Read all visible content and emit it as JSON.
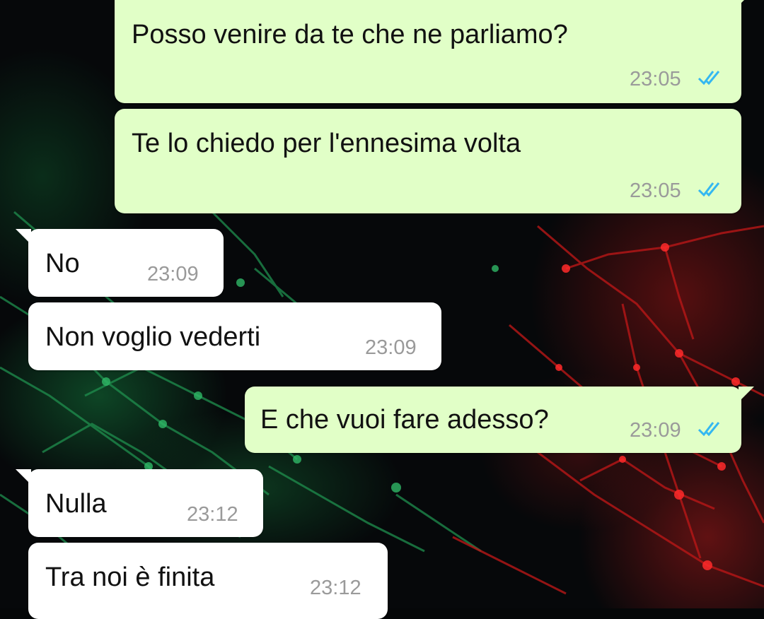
{
  "chat": {
    "messages": [
      {
        "direction": "outgoing",
        "text": "Posso venire da te che ne parliamo?",
        "time": "23:05",
        "status": "read"
      },
      {
        "direction": "outgoing",
        "text": "Te lo chiedo per l'ennesima volta",
        "time": "23:05",
        "status": "read"
      },
      {
        "direction": "incoming",
        "text": "No",
        "time": "23:09"
      },
      {
        "direction": "incoming",
        "text": "Non voglio vederti",
        "time": "23:09"
      },
      {
        "direction": "outgoing",
        "text": "E che vuoi fare adesso?",
        "time": "23:09",
        "status": "read"
      },
      {
        "direction": "incoming",
        "text": "Nulla",
        "time": "23:12"
      },
      {
        "direction": "incoming",
        "text": "Tra noi è finita",
        "time": "23:12"
      }
    ]
  },
  "colors": {
    "outgoing_bubble": "#e1ffc7",
    "incoming_bubble": "#ffffff",
    "read_ticks": "#34b7f1",
    "timestamp": "#9a9a9a",
    "wallpaper_green": "#1a8a4a",
    "wallpaper_red": "#d01818"
  },
  "icons": {
    "read_receipt": "double-check-icon"
  }
}
